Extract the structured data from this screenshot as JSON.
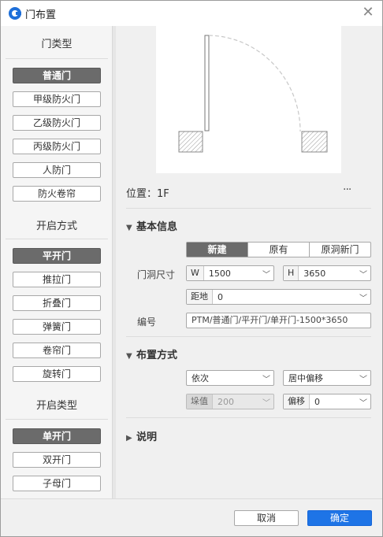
{
  "window": {
    "title": "门布置",
    "close_icon": "close-icon"
  },
  "left": {
    "door_type_title": "门类型",
    "door_types": [
      "普通门",
      "甲级防火门",
      "乙级防火门",
      "丙级防火门",
      "人防门",
      "防火卷帘"
    ],
    "door_type_selected": "普通门",
    "open_mode_title": "开启方式",
    "open_modes": [
      "平开门",
      "推拉门",
      "折叠门",
      "弹簧门",
      "卷帘门",
      "旋转门"
    ],
    "open_mode_selected": "平开门",
    "open_kind_title": "开启类型",
    "open_kinds": [
      "单开门",
      "双开门",
      "子母门"
    ],
    "open_kind_selected": "单开门"
  },
  "location": {
    "label": "位置：1F",
    "more_icon": "more-icon"
  },
  "basic_info": {
    "title": "基本信息",
    "mode_tabs": [
      "新建",
      "原有",
      "原洞新门"
    ],
    "mode_selected": "新建",
    "opening_size_label": "门洞尺寸",
    "width_prefix": "W",
    "width_value": "1500",
    "height_prefix": "H",
    "height_value": "3650",
    "sill_prefix": "距地",
    "sill_value": "0",
    "code_label": "编号",
    "code_value": "PTM/普通门/平开门/单开门-1500*3650"
  },
  "placement": {
    "title": "布置方式",
    "method_value": "依次",
    "offset_mode_value": "居中偏移",
    "value_prefix": "垛值",
    "value_value": "200",
    "offset_prefix": "偏移",
    "offset_value": "0"
  },
  "notes": {
    "title": "说明"
  },
  "footer": {
    "cancel_label": "取消",
    "ok_label": "确定"
  },
  "colors": {
    "accent": "#1e74e6",
    "selected": "#6b6b6b"
  }
}
